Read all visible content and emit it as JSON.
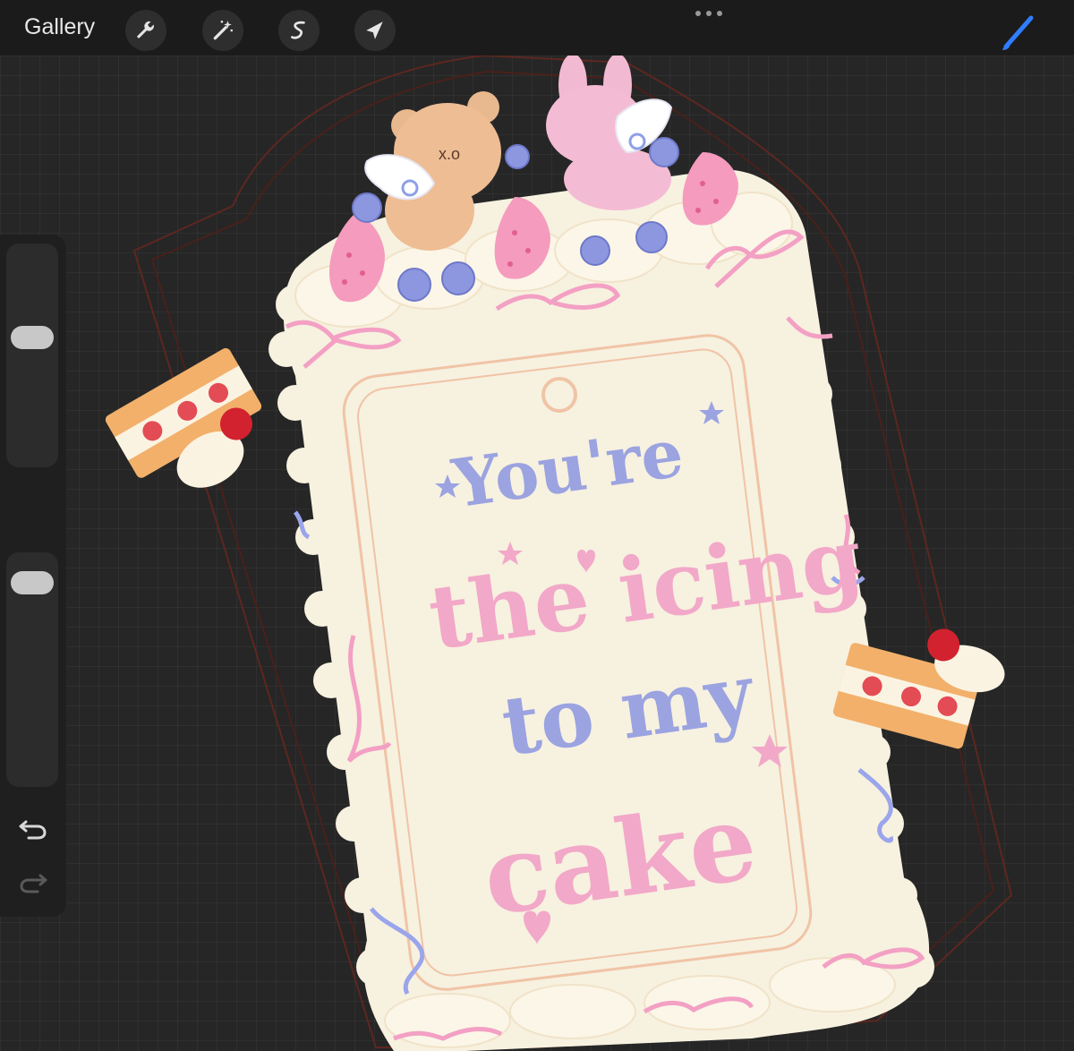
{
  "app": {
    "gallery_label": "Gallery"
  },
  "toolbar": {
    "tools": [
      {
        "name": "actions-wrench-icon"
      },
      {
        "name": "adjustments-magic-wand-icon"
      },
      {
        "name": "selection-icon"
      },
      {
        "name": "transform-arrow-icon"
      }
    ],
    "active_tool": "brush",
    "accent_color": "#2f7dff"
  },
  "sidebar": {
    "brush_size_level": 0.6,
    "opacity_level": 0.95
  },
  "artwork": {
    "lines": [
      "You're",
      "the icing",
      "to my",
      "cake"
    ],
    "colors": {
      "card": "#f7f1e0",
      "pink": "#f2a8c8",
      "lavender": "#9ba3e0",
      "outline": "#6b2a22"
    }
  }
}
